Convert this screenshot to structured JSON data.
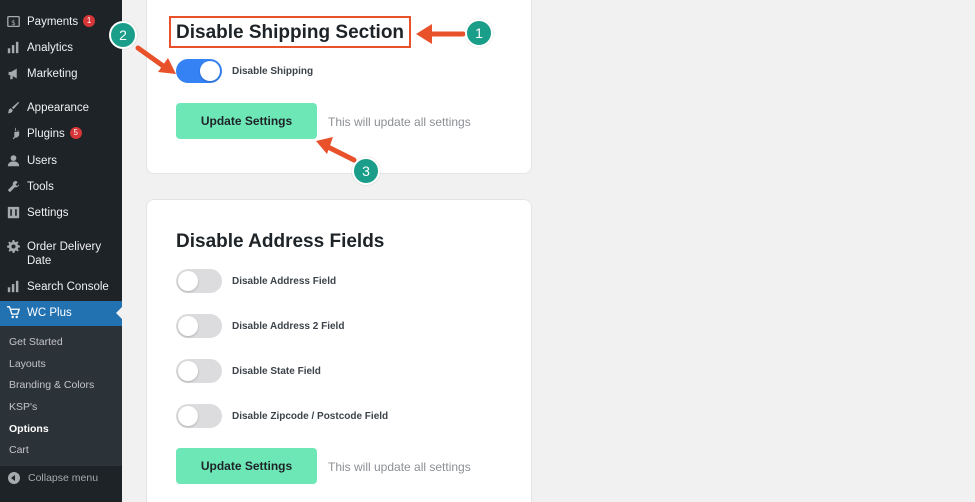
{
  "sidebar": {
    "items": [
      {
        "label": "Payments",
        "badge": "1",
        "icon": "dollar-icon"
      },
      {
        "label": "Analytics",
        "icon": "bar-chart-icon"
      },
      {
        "label": "Marketing",
        "icon": "megaphone-icon"
      },
      {
        "label": "Appearance",
        "icon": "paintbrush-icon"
      },
      {
        "label": "Plugins",
        "badge": "5",
        "icon": "plug-icon"
      },
      {
        "label": "Users",
        "icon": "user-icon"
      },
      {
        "label": "Tools",
        "icon": "wrench-icon"
      },
      {
        "label": "Settings",
        "icon": "sliders-icon"
      },
      {
        "label": "Order Delivery",
        "label2": "Date",
        "icon": "gear-icon"
      },
      {
        "label": "Search Console",
        "icon": "bar-chart-icon"
      },
      {
        "label": "WC Plus",
        "icon": "cart-icon"
      }
    ],
    "submenu": [
      "Get Started",
      "Layouts",
      "Branding & Colors",
      "KSP's",
      "Options",
      "Cart"
    ],
    "current_submenu": "Options",
    "collapse_label": "Collapse menu"
  },
  "shipping": {
    "title": "Disable Shipping Section",
    "toggle_label": "Disable Shipping",
    "toggle_on": true,
    "button_label": "Update Settings",
    "hint": "This will update all settings"
  },
  "address": {
    "title": "Disable Address Fields",
    "toggles": [
      {
        "label": "Disable Address Field",
        "on": false
      },
      {
        "label": "Disable Address 2 Field",
        "on": false
      },
      {
        "label": "Disable State Field",
        "on": false
      },
      {
        "label": "Disable Zipcode / Postcode Field",
        "on": false
      }
    ],
    "button_label": "Update Settings",
    "hint": "This will update all settings"
  },
  "annotations": {
    "steps": [
      "1",
      "2",
      "3"
    ],
    "arrow_color": "#e8512a",
    "step_color": "#1a9e8a"
  },
  "colors": {
    "sidebar_bg": "#1d2327",
    "active_menu": "#2271b1",
    "button_bg": "#6ee7b7",
    "toggle_on": "#3582f4"
  }
}
